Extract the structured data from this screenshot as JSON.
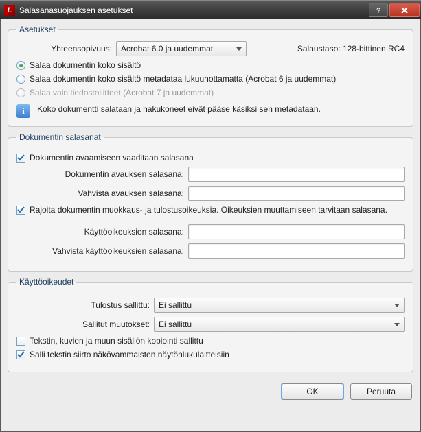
{
  "window": {
    "title": "Salasanasuojauksen asetukset"
  },
  "settings": {
    "legend": "Asetukset",
    "compat_label": "Yhteensopivuus:",
    "compat_value": "Acrobat 6.0 ja uudemmat",
    "enc_label": "Salaustaso:",
    "enc_value": "128-bittinen RC4",
    "opt1": "Salaa dokumentin koko sisältö",
    "opt2": "Salaa dokumentin koko sisältö metadataa lukuunottamatta (Acrobat 6 ja uudemmat)",
    "opt3": "Salaa vain tiedostoliitteet  (Acrobat 7 ja uudemmat)",
    "info": "Koko dokumentti salataan ja hakukoneet eivät pääse käsiksi sen metadataan."
  },
  "passwords": {
    "legend": "Dokumentin salasanat",
    "require_open": "Dokumentin avaamiseen vaaditaan salasana",
    "open_pw": "Dokumentin avauksen salasana:",
    "open_pw_confirm": "Vahvista avauksen salasana:",
    "restrict": "Rajoita dokumentin muokkaus- ja tulostusoikeuksia. Oikeuksien muuttamiseen tarvitaan salasana.",
    "perm_pw": "Käyttöoikeuksien salasana:",
    "perm_pw_confirm": "Vahvista käyttöoikeuksien salasana:"
  },
  "permissions": {
    "legend": "Käyttöoikeudet",
    "print_label": "Tulostus sallittu:",
    "print_value": "Ei sallittu",
    "changes_label": "Sallitut muutokset:",
    "changes_value": "Ei sallittu",
    "copy": "Tekstin, kuvien ja muun sisällön kopiointi sallittu",
    "access": "Salli tekstin siirto näkövammaisten näytönlukulaitteisiin"
  },
  "footer": {
    "ok": "OK",
    "cancel": "Peruuta"
  }
}
